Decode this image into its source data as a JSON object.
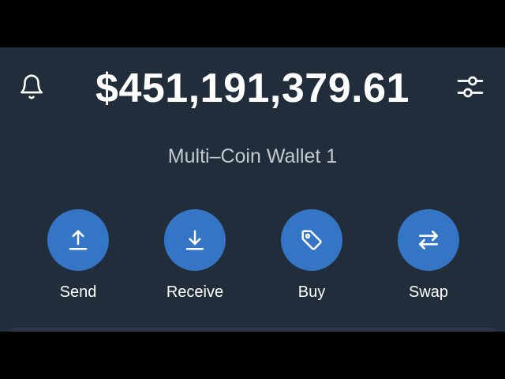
{
  "header": {
    "balance": "$451,191,379.61",
    "left_icon": "bell-icon",
    "right_icon": "sliders-icon"
  },
  "wallet": {
    "name": "Multi–Coin Wallet 1"
  },
  "actions": [
    {
      "label": "Send",
      "icon": "upload-arrow-icon"
    },
    {
      "label": "Receive",
      "icon": "download-arrow-icon"
    },
    {
      "label": "Buy",
      "icon": "price-tag-icon"
    },
    {
      "label": "Swap",
      "icon": "swap-arrows-icon"
    }
  ],
  "colors": {
    "background": "#222d3b",
    "accent": "#3476c5",
    "text_primary": "#ffffff",
    "text_secondary": "#c3c8d0"
  }
}
